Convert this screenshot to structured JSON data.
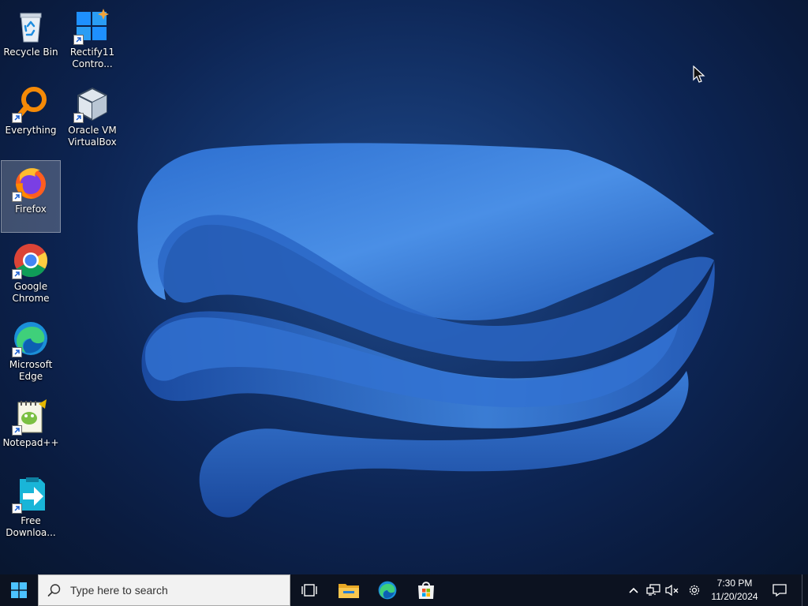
{
  "desktop": {
    "icons": [
      {
        "id": "recycle-bin",
        "label": "Recycle Bin",
        "icon": "recycle-bin-icon",
        "shortcut": false
      },
      {
        "id": "rectify11",
        "label": "Rectify11\nContro...",
        "icon": "control-panel-icon",
        "shortcut": true
      },
      {
        "id": "everything",
        "label": "Everything",
        "icon": "everything-search-icon",
        "shortcut": true
      },
      {
        "id": "virtualbox",
        "label": "Oracle VM\nVirtualBox",
        "icon": "virtualbox-icon",
        "shortcut": true
      },
      {
        "id": "firefox",
        "label": "Firefox",
        "icon": "firefox-icon",
        "shortcut": true,
        "selected": true
      },
      {
        "id": "chrome",
        "label": "Google\nChrome",
        "icon": "chrome-icon",
        "shortcut": true
      },
      {
        "id": "edge",
        "label": "Microsoft\nEdge",
        "icon": "edge-icon",
        "shortcut": true
      },
      {
        "id": "notepadpp",
        "label": "Notepad++",
        "icon": "notepadpp-icon",
        "shortcut": true
      },
      {
        "id": "fdm",
        "label": "Free\nDownloa...",
        "icon": "free-download-manager-icon",
        "shortcut": true
      }
    ]
  },
  "taskbar": {
    "search_placeholder": "Type here to search",
    "pinned": [
      "task-view-icon",
      "file-explorer-icon",
      "edge-icon",
      "microsoft-store-icon"
    ],
    "tray": [
      "chevron-up-icon",
      "network-icon",
      "volume-muted-icon",
      "settings-gear-icon"
    ],
    "time": "7:30 PM",
    "date": "11/20/2024"
  },
  "colors": {
    "taskbar_bg": "#0c1220",
    "accent": "#2b7de1",
    "wallpaper_dark": "#0a1b3e",
    "wallpaper_ribbon": "#3a7bd5"
  }
}
